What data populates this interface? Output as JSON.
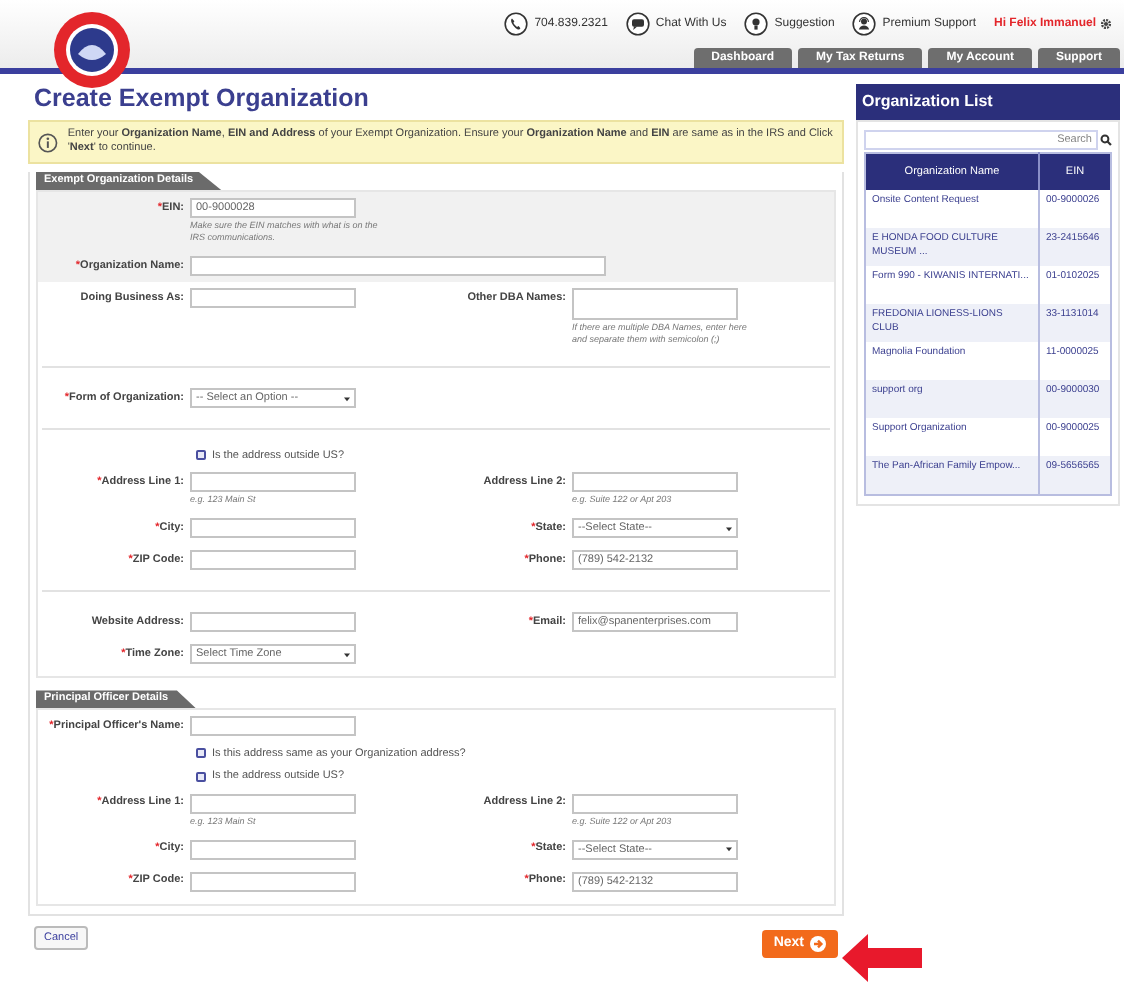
{
  "header": {
    "contacts": [
      {
        "kind": "phone",
        "label": "704.839.2321"
      },
      {
        "kind": "chat",
        "label": "Chat With Us"
      },
      {
        "kind": "suggestion",
        "label": "Suggestion"
      },
      {
        "kind": "support",
        "label": "Premium Support"
      }
    ],
    "greeting": "Hi Felix Immanuel"
  },
  "nav_tabs": [
    "Dashboard",
    "My Tax Returns",
    "My Account",
    "Support"
  ],
  "page_title": "Create Exempt Organization",
  "notice": "Enter your **Organization Name**, **EIN and Address** of your Exempt Organization. Ensure your **Organization Name** and **EIN** are same as in the IRS and Click '**Next**' to continue.",
  "sections": [
    {
      "title": "Exempt Organization Details",
      "rows": [
        {
          "kind": "fields",
          "shaded": true,
          "fields": [
            {
              "mark": "*",
              "label": "EIN:",
              "kind": "input",
              "value": "00-9000028",
              "hint": "Make sure the EIN matches with what is on the IRS communications."
            }
          ]
        },
        {
          "kind": "fields",
          "shaded": true,
          "fields": [
            {
              "mark": "*",
              "label": "Organization Name:",
              "kind": "wide_input"
            }
          ]
        },
        {
          "kind": "fields",
          "shaded": false,
          "fields": [
            {
              "label": "Doing Business As:",
              "kind": "input"
            },
            {
              "label": "Other DBA Names:",
              "kind": "textarea",
              "hint": "If there are multiple DBA Names, enter here and separate them with semicolon (;)"
            }
          ]
        },
        {
          "kind": "divider"
        },
        {
          "kind": "fields",
          "shaded": false,
          "fields": [
            {
              "mark": "*",
              "label": "Form of Organization:",
              "kind": "select",
              "placeholder": "-- Select an Option --"
            }
          ]
        },
        {
          "kind": "divider"
        },
        {
          "kind": "checkbox",
          "label": "Is the address outside US?",
          "checked": false
        },
        {
          "kind": "fields",
          "shaded": false,
          "fields": [
            {
              "mark": "*",
              "label": "Address Line 1:",
              "kind": "input",
              "hint": "e.g. 123 Main St"
            },
            {
              "label": "Address Line 2:",
              "kind": "input",
              "hint": "e.g. Suite 122 or Apt 203"
            }
          ]
        },
        {
          "kind": "fields",
          "shaded": false,
          "fields": [
            {
              "mark": "*",
              "label": "City:",
              "kind": "input"
            },
            {
              "mark": "*",
              "label": "State:",
              "kind": "select",
              "placeholder": "--Select State--"
            }
          ]
        },
        {
          "kind": "fields",
          "shaded": false,
          "fields": [
            {
              "mark": "*",
              "label": "ZIP Code:",
              "kind": "input"
            },
            {
              "mark": "*",
              "label": "Phone:",
              "kind": "input",
              "value": "(789) 542-2132"
            }
          ]
        },
        {
          "kind": "divider"
        },
        {
          "kind": "fields",
          "shaded": false,
          "fields": [
            {
              "label": "Website Address:",
              "kind": "input"
            },
            {
              "mark": "*",
              "label": "Email:",
              "kind": "input",
              "value": "felix@spanenterprises.com"
            }
          ]
        },
        {
          "kind": "fields",
          "shaded": false,
          "fields": [
            {
              "mark": "*",
              "label": "Time Zone:",
              "kind": "select",
              "placeholder": "Select Time Zone"
            }
          ]
        }
      ]
    },
    {
      "title": "Principal Officer Details",
      "rows": [
        {
          "kind": "fields",
          "shaded": false,
          "fields": [
            {
              "mark": "*",
              "label": "Principal Officer's Name:",
              "kind": "input"
            }
          ]
        },
        {
          "kind": "checkbox",
          "label": "Is this address same as your Organization address?",
          "checked": false
        },
        {
          "kind": "checkbox",
          "label": "Is the address outside US?",
          "checked": false
        },
        {
          "kind": "fields",
          "shaded": false,
          "fields": [
            {
              "mark": "*",
              "label": "Address Line 1:",
              "kind": "input",
              "hint": "e.g. 123 Main St"
            },
            {
              "label": "Address Line 2:",
              "kind": "input",
              "hint": "e.g. Suite 122 or Apt 203"
            }
          ]
        },
        {
          "kind": "fields",
          "shaded": false,
          "fields": [
            {
              "mark": "*",
              "label": "City:",
              "kind": "input"
            },
            {
              "mark": "*",
              "label": "State:",
              "kind": "select",
              "placeholder": "--Select State--"
            }
          ]
        },
        {
          "kind": "fields",
          "shaded": false,
          "fields": [
            {
              "mark": "*",
              "label": "ZIP Code:",
              "kind": "input"
            },
            {
              "mark": "*",
              "label": "Phone:",
              "kind": "input",
              "value": "(789) 542-2132"
            }
          ]
        }
      ]
    }
  ],
  "buttons": {
    "cancel": "Cancel",
    "next": "Next"
  },
  "sidebar": {
    "title": "Organization List",
    "search_placeholder": "Search",
    "columns": [
      "Organization Name",
      "EIN"
    ],
    "rows": [
      {
        "name": "Onsite Content Request",
        "ein": "00-9000026"
      },
      {
        "name": "E HONDA FOOD CULTURE MUSEUM ...",
        "ein": "23-2415646"
      },
      {
        "name": "Form 990 - KIWANIS INTERNATI...",
        "ein": "01-0102025"
      },
      {
        "name": "FREDONIA LIONESS-LIONS CLUB",
        "ein": "33-1131014"
      },
      {
        "name": "Magnolia Foundation",
        "ein": "11-0000025"
      },
      {
        "name": "support org",
        "ein": "00-9000030"
      },
      {
        "name": "Support Organization",
        "ein": "00-9000025"
      },
      {
        "name": "The Pan-African Family Empow...",
        "ein": "09-5656565"
      }
    ]
  }
}
